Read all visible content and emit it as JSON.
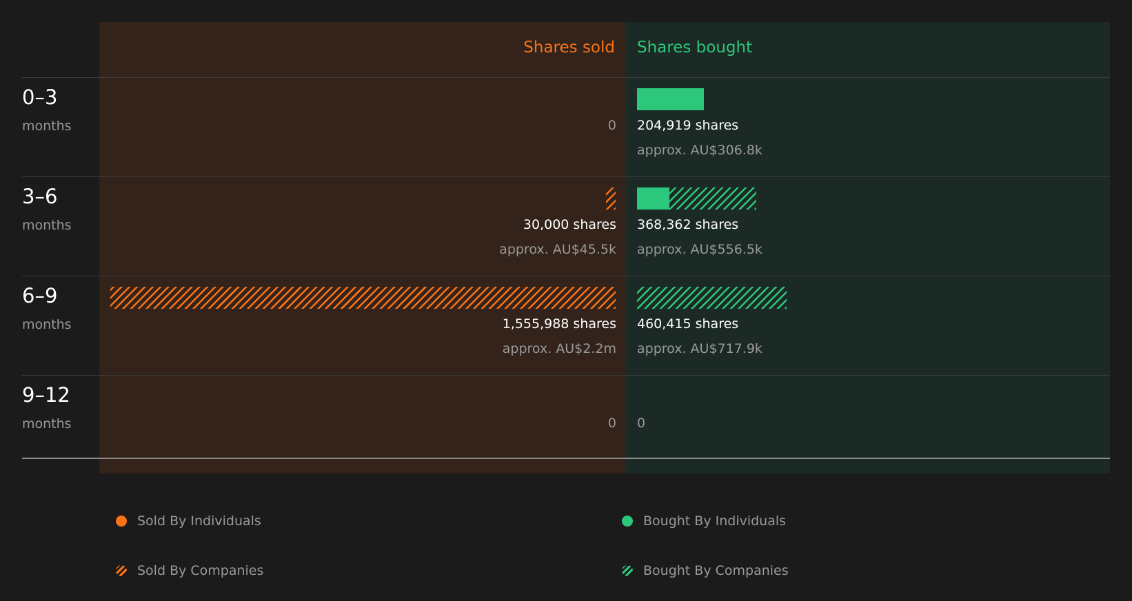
{
  "colors": {
    "sold": "#f97316",
    "bought": "#2dc77c",
    "sold_panel": "#33231b",
    "bought_panel": "#1b2a24",
    "background": "#1b1b1b"
  },
  "headers": {
    "sold": "Shares sold",
    "bought": "Shares bought"
  },
  "chart_data": {
    "type": "bar",
    "orientation": "horizontal-diverging",
    "categories": [
      "0–3",
      "3–6",
      "6–9",
      "9–12"
    ],
    "category_unit": "months",
    "series": [
      {
        "name": "Sold By Individuals",
        "side": "sold",
        "style": "solid",
        "values": [
          0,
          0,
          0,
          0
        ]
      },
      {
        "name": "Sold By Companies",
        "side": "sold",
        "style": "hatched",
        "values": [
          0,
          30000,
          1555988,
          0
        ]
      },
      {
        "name": "Bought By Individuals",
        "side": "bought",
        "style": "solid",
        "values": [
          204919,
          100000,
          0,
          0
        ]
      },
      {
        "name": "Bought By Companies",
        "side": "bought",
        "style": "hatched",
        "values": [
          0,
          268362,
          460415,
          0
        ]
      }
    ],
    "scale_max": 1555988,
    "rows": [
      {
        "period": "0–3",
        "unit": "months",
        "sold": {
          "total": 0,
          "shares_text": "",
          "approx_text": "",
          "zero_text": "0"
        },
        "bought": {
          "total": 204919,
          "shares_text": "204,919 shares",
          "approx_text": "approx. AU$306.8k",
          "zero_text": ""
        }
      },
      {
        "period": "3–6",
        "unit": "months",
        "sold": {
          "total": 30000,
          "shares_text": "30,000 shares",
          "approx_text": "approx. AU$45.5k",
          "zero_text": ""
        },
        "bought": {
          "total": 368362,
          "shares_text": "368,362 shares",
          "approx_text": "approx. AU$556.5k",
          "zero_text": ""
        }
      },
      {
        "period": "6–9",
        "unit": "months",
        "sold": {
          "total": 1555988,
          "shares_text": "1,555,988 shares",
          "approx_text": "approx. AU$2.2m",
          "zero_text": ""
        },
        "bought": {
          "total": 460415,
          "shares_text": "460,415 shares",
          "approx_text": "approx. AU$717.9k",
          "zero_text": ""
        }
      },
      {
        "period": "9–12",
        "unit": "months",
        "sold": {
          "total": 0,
          "shares_text": "",
          "approx_text": "",
          "zero_text": "0"
        },
        "bought": {
          "total": 0,
          "shares_text": "",
          "approx_text": "",
          "zero_text": "0"
        }
      }
    ]
  },
  "legend": [
    {
      "label": "Sold By Individuals",
      "side": "sold",
      "style": "solid"
    },
    {
      "label": "Bought By Individuals",
      "side": "bought",
      "style": "solid"
    },
    {
      "label": "Sold By Companies",
      "side": "sold",
      "style": "hatched"
    },
    {
      "label": "Bought By Companies",
      "side": "bought",
      "style": "hatched"
    }
  ]
}
